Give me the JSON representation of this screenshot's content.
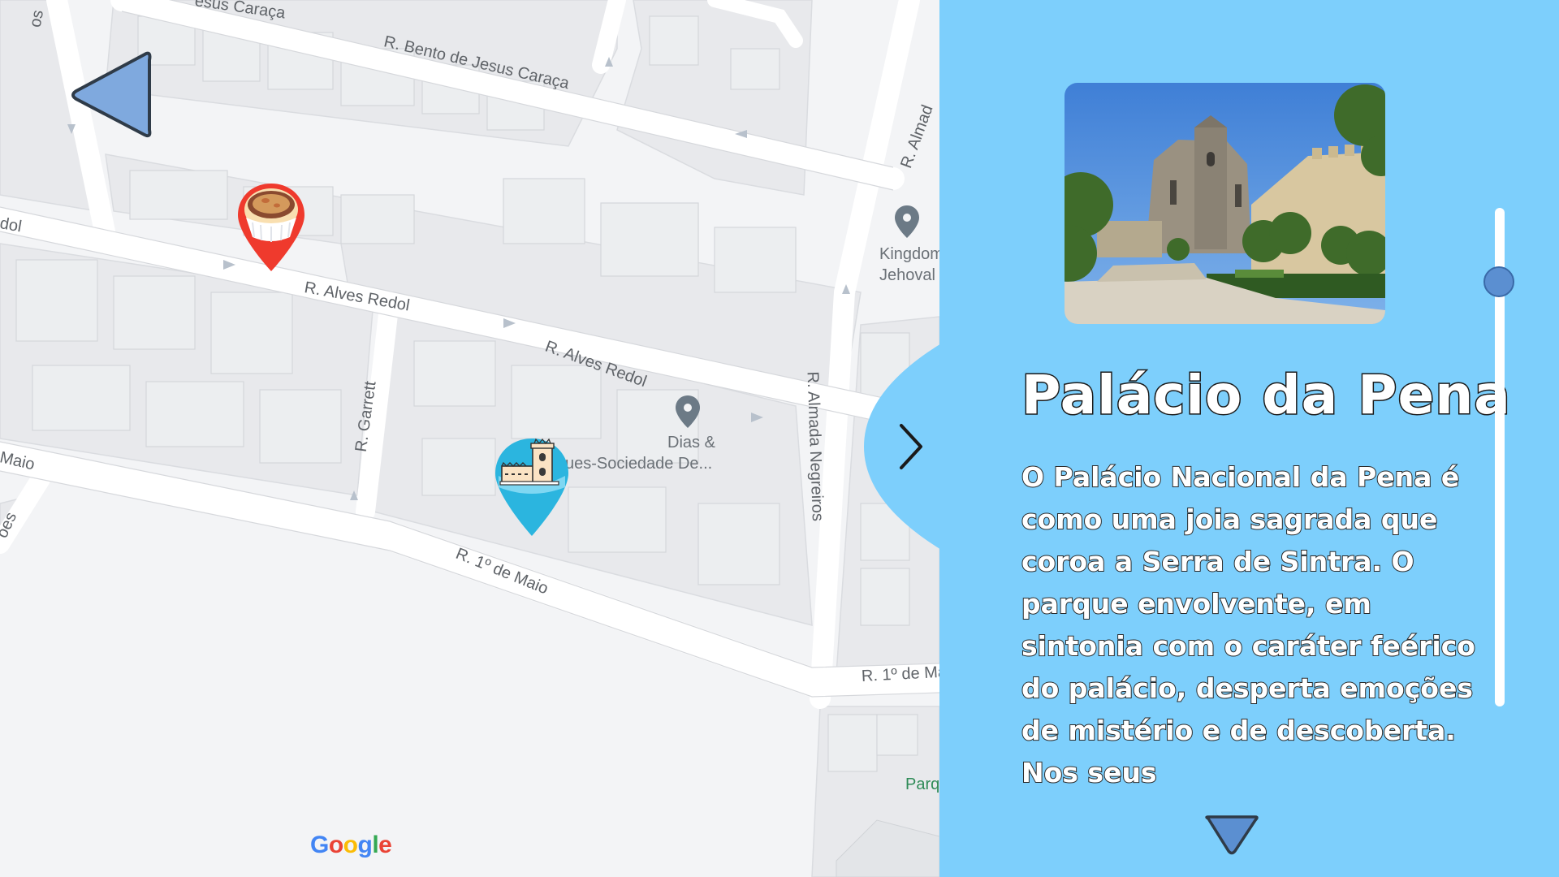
{
  "map": {
    "streets": {
      "bento_de_jesus": "R. Bento de Jesus Caraça",
      "jesus_caraca_top": "esus Caraça",
      "alves_redol_1": "R. Alves Redol",
      "alves_redol_2": "R. Alves Redol",
      "alves_redol_left": "dol",
      "garrett": "R. Garrett",
      "almada_negreiros": "R. Almada Negreiros",
      "almada_top": "R. Almad",
      "primeiro_de_maio_1": "R. 1º de Maio",
      "primeiro_de_maio_2": "R. 1º de Ma",
      "maio_left": "Maio",
      "os_left": "os",
      "oes_left": "oes"
    },
    "pois": {
      "kingdom_line1": "Kingdom",
      "kingdom_line2": "Jehoval",
      "dias_line1": "Dias &",
      "dias_line2": "ues-Sociedade De..."
    },
    "park_label": "Parq",
    "google_logo": [
      "G",
      "o",
      "o",
      "g",
      "l",
      "e"
    ]
  },
  "icons": {
    "back": "triangle-left-icon",
    "pastry_pin": "pastel-de-nata-pin-icon",
    "tower_pin": "belem-tower-pin-icon",
    "next": "chevron-right-icon",
    "scroll_down": "triangle-down-icon"
  },
  "panel": {
    "title": "Palácio da Pena",
    "description": "O Palácio Nacional da Pena é como uma joia sagrada que coroa a Serra de Sintra. O parque envolvente, em sintonia com o caráter feérico do palácio, desperta emoções de mistério e de descoberta. Nos seus",
    "scroll_position": 0.12
  },
  "colors": {
    "panel_bg": "#7dcffc",
    "back_button": "#7fa9de",
    "scroll_thumb": "#5b8fd1",
    "pin_red": "#ef3a2d",
    "pin_blue": "#2bb5df"
  }
}
